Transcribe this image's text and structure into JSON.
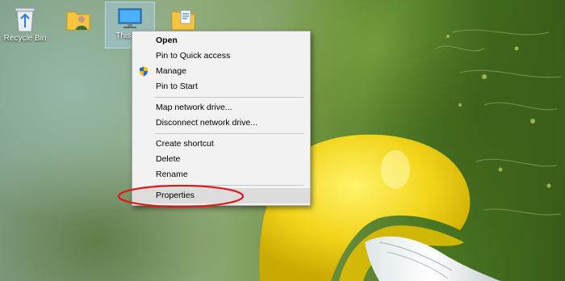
{
  "desktop_icons": [
    {
      "label": "Recycle Bin",
      "icon": "recycle-bin-icon"
    },
    {
      "label": "",
      "icon": "user-folder-icon"
    },
    {
      "label": "This PC",
      "icon": "this-pc-icon"
    },
    {
      "label": "",
      "icon": "document-folder-icon"
    }
  ],
  "context_menu": {
    "items": [
      {
        "label": "Open"
      },
      {
        "label": "Pin to Quick access"
      },
      {
        "label": "Manage",
        "icon": "uac-shield-icon"
      },
      {
        "label": "Pin to Start"
      },
      {
        "label": "Map network drive..."
      },
      {
        "label": "Disconnect network drive..."
      },
      {
        "label": "Create shortcut"
      },
      {
        "label": "Delete"
      },
      {
        "label": "Rename"
      },
      {
        "label": "Properties"
      }
    ]
  },
  "colors": {
    "menu_background": "#f2f2f2",
    "menu_highlight": "#dcdcdc",
    "annotation_circle": "#e01818",
    "selection": "#add6ff"
  }
}
